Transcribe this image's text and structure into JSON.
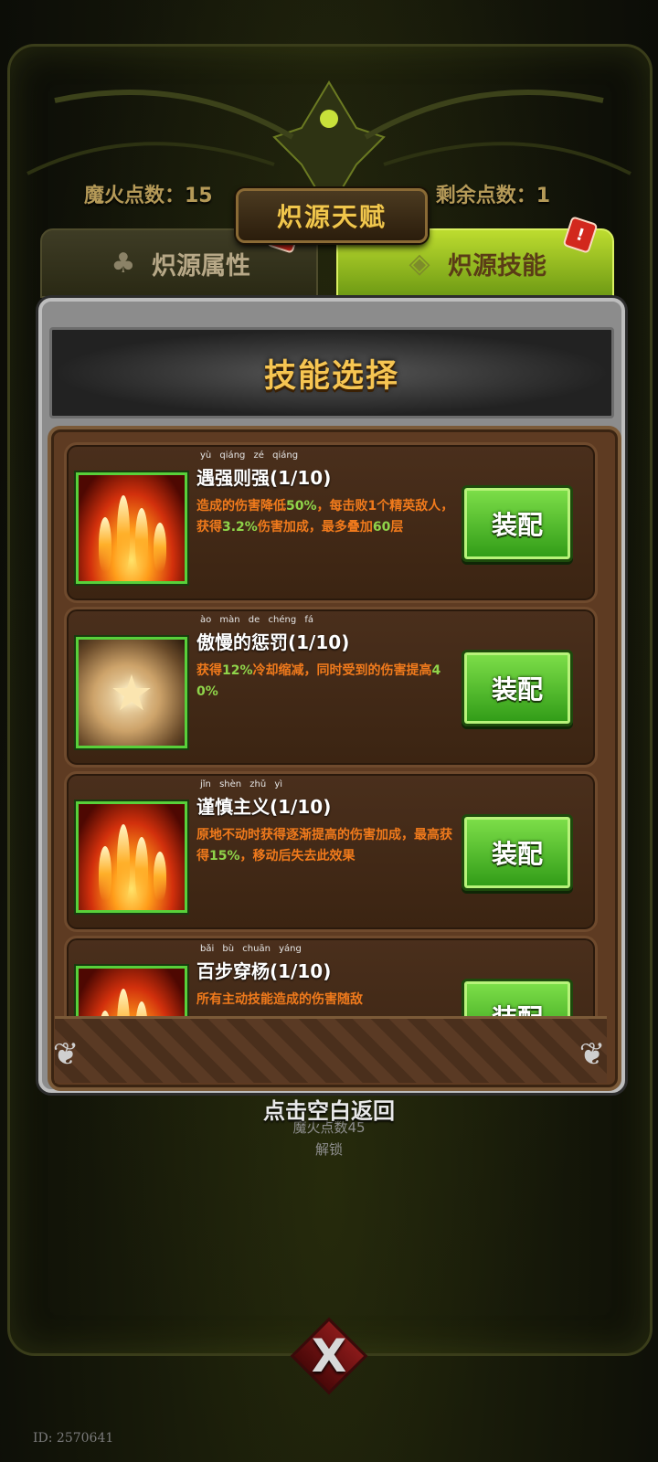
{
  "header": {
    "title": "炽源天赋",
    "magic_fire_points": "魔火点数：15",
    "remaining_points": "剩余点数：1"
  },
  "tabs": [
    {
      "label": "炽源属性",
      "icon": "clover-icon",
      "badge": "!",
      "active": false
    },
    {
      "label": "炽源技能",
      "icon": "diamond-cross-icon",
      "badge": "!",
      "active": true
    }
  ],
  "panel": {
    "title": "技能选择"
  },
  "skills": [
    {
      "pinyin": "yù qiáng zé qiáng",
      "name": "遇强则强(1/10)",
      "icon": "fire-burst-icon",
      "desc_parts": [
        "造成的伤害降低",
        "50%",
        "，每击败1个精英敌人，获得",
        "3.2%",
        "伤害加成，最多叠加",
        "60",
        "层"
      ],
      "button": "装配"
    },
    {
      "pinyin": "ào màn de chéng fá",
      "name": "傲慢的惩罚(1/10)",
      "icon": "star-orb-icon",
      "desc_parts": [
        "获得",
        "12%",
        "冷却缩减，同时受到的伤害提高",
        "40%",
        ""
      ],
      "button": "装配"
    },
    {
      "pinyin": "jǐn shèn zhǔ yì",
      "name": "谨慎主义(1/10)",
      "icon": "fire-burst-icon",
      "desc_parts": [
        "原地不动时获得逐渐提高的伤害加成，最高获得",
        "15%",
        "，移动后失去此效果",
        "",
        ""
      ],
      "button": "装配"
    },
    {
      "pinyin": "bǎi bù chuān yáng",
      "name": "百步穿杨(1/10)",
      "icon": "fire-burst-icon",
      "desc_parts": [
        "所有主动技能造成的伤害随敌",
        "",
        "",
        "",
        ""
      ],
      "button": "装配"
    }
  ],
  "footer": {
    "hint": "点击空白返回",
    "unlock_line1": "魔火点数45",
    "unlock_line2": "解锁",
    "close_label": "X",
    "id_text": "ID: 2570641"
  },
  "colors": {
    "accent_gold": "#f6c552",
    "desc_orange": "#f07a1c",
    "highlight_green": "#8fd44a",
    "button_green": "#2f9a16"
  }
}
